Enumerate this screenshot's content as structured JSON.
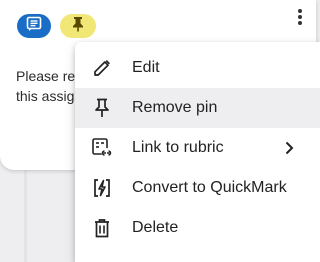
{
  "card": {
    "text_lines": [
      "Please re",
      "this assig"
    ],
    "colors": {
      "comment_badge": "#1a6dc6",
      "pin_badge": "#f1e777"
    },
    "icons": {
      "comment": "comment-icon",
      "pin": "pin-icon",
      "more": "more-vertical-icon"
    }
  },
  "menu": {
    "items": [
      {
        "label": "Edit",
        "icon": "pencil-icon"
      },
      {
        "label": "Remove pin",
        "icon": "pin-icon",
        "hovered": true
      },
      {
        "label": "Link to rubric",
        "icon": "rubric-link-icon",
        "submenu": "chevron-right-icon"
      },
      {
        "label": "Convert to QuickMark",
        "icon": "quickmark-icon"
      },
      {
        "label": "Delete",
        "icon": "trash-icon"
      }
    ]
  }
}
